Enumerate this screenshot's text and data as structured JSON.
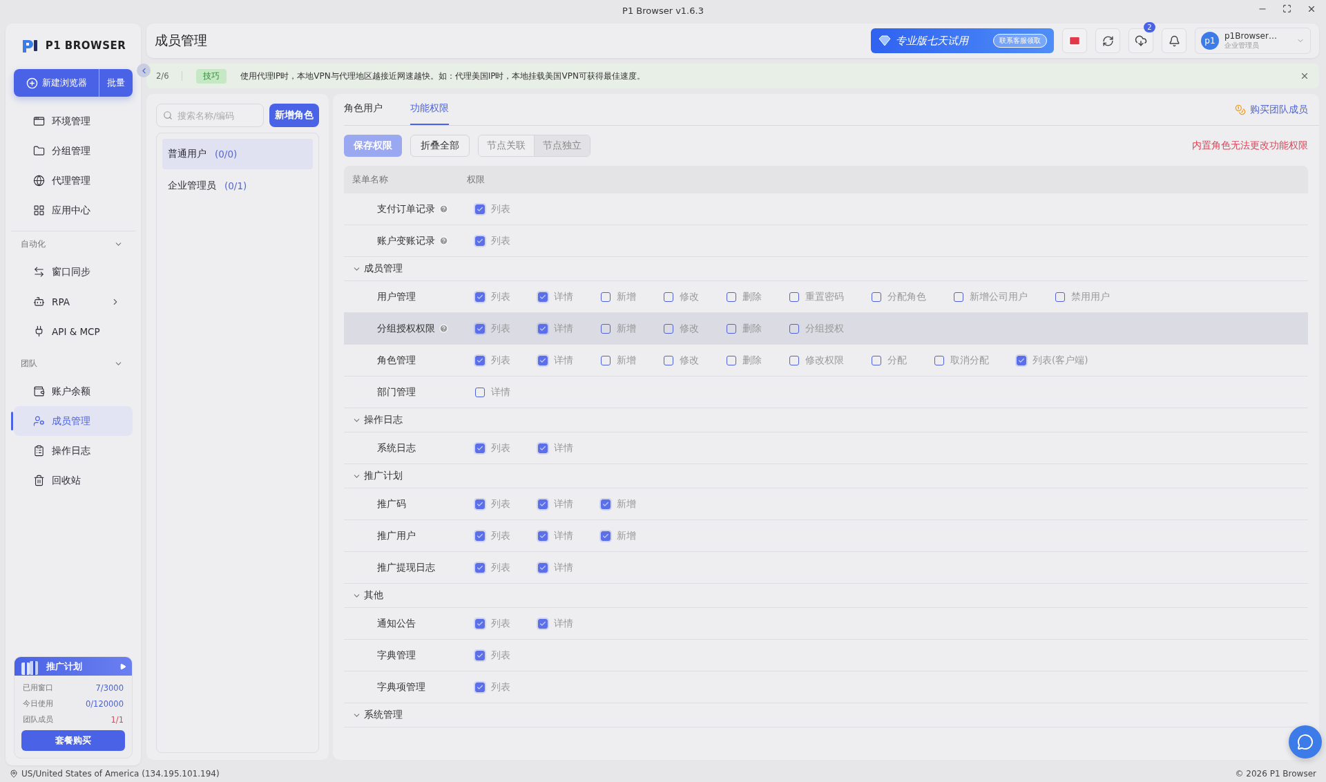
{
  "window": {
    "title": "P1 Browser v1.6.3"
  },
  "sidebar": {
    "logo": "P1 BROWSER",
    "new_button": "新建浏览器",
    "batch_button": "批量",
    "items": [
      {
        "label": "环境管理",
        "selected": false
      },
      {
        "label": "分组管理",
        "selected": false
      },
      {
        "label": "代理管理",
        "selected": false
      },
      {
        "label": "应用中心",
        "selected": false
      }
    ],
    "sections": [
      {
        "title": "自动化",
        "expanded": true,
        "items": [
          {
            "label": "窗口同步",
            "selected": false,
            "has_submenu": false
          },
          {
            "label": "RPA",
            "selected": false,
            "has_submenu": true
          },
          {
            "label": "API & MCP",
            "selected": false,
            "has_submenu": false
          }
        ]
      },
      {
        "title": "团队",
        "expanded": true,
        "items": [
          {
            "label": "账户余额",
            "selected": false,
            "has_submenu": false
          },
          {
            "label": "成员管理",
            "selected": true,
            "has_submenu": false
          },
          {
            "label": "操作日志",
            "selected": false,
            "has_submenu": false
          },
          {
            "label": "回收站",
            "selected": false,
            "has_submenu": false
          }
        ]
      }
    ],
    "promo": {
      "title": "推广计划",
      "stats": [
        {
          "label": "已用窗口",
          "value": "7/3000",
          "color": "#4a5fcf"
        },
        {
          "label": "今日使用",
          "value": "0/120000",
          "color": "#4a5fcf"
        },
        {
          "label": "团队成员",
          "value": "1/1",
          "color": "#d9475a"
        }
      ],
      "button": "套餐购买"
    }
  },
  "header": {
    "title": "成员管理",
    "trial": {
      "label": "专业版七天试用",
      "action": "联系客服领取"
    },
    "download_badge": "2",
    "user": {
      "avatar": "p1",
      "name": "p1Browser…",
      "role": "企业管理员"
    }
  },
  "tip": {
    "counter": "2/6",
    "badge": "技巧",
    "text": "使用代理IP时，本地VPN与代理地区越接近网速越快。如：代理美国IP时，本地挂载美国VPN可获得最佳速度。"
  },
  "roles": {
    "search_placeholder": "搜索名称/编码",
    "add_button": "新增角色",
    "items": [
      {
        "name": "普通用户",
        "count": "(0/0)",
        "selected": true
      },
      {
        "name": "企业管理员",
        "count": "(0/1)",
        "selected": false
      }
    ]
  },
  "permissions": {
    "tabs": [
      {
        "label": "角色用户",
        "selected": false
      },
      {
        "label": "功能权限",
        "selected": true
      }
    ],
    "buy_link": "购买团队成员",
    "save_button": "保存权限",
    "collapse_button": "折叠全部",
    "modes": [
      {
        "label": "节点关联",
        "selected": false
      },
      {
        "label": "节点独立",
        "selected": true
      }
    ],
    "notice": "内置角色无法更改功能权限",
    "columns": [
      "菜单名称",
      "权限"
    ],
    "rows": [
      {
        "kind": "item",
        "name": "支付订单记录",
        "help": true,
        "hovered": false,
        "options": [
          {
            "label": "列表",
            "checked": true
          }
        ]
      },
      {
        "kind": "item",
        "name": "账户变账记录",
        "help": true,
        "hovered": false,
        "options": [
          {
            "label": "列表",
            "checked": true
          }
        ]
      },
      {
        "kind": "group",
        "name": "成员管理",
        "expanded": true
      },
      {
        "kind": "item",
        "name": "用户管理",
        "help": false,
        "hovered": false,
        "options": [
          {
            "label": "列表",
            "checked": true
          },
          {
            "label": "详情",
            "checked": true
          },
          {
            "label": "新增",
            "checked": false
          },
          {
            "label": "修改",
            "checked": false
          },
          {
            "label": "删除",
            "checked": false
          },
          {
            "label": "重置密码",
            "checked": false
          },
          {
            "label": "分配角色",
            "checked": false
          },
          {
            "label": "新增公司用户",
            "checked": false
          },
          {
            "label": "禁用用户",
            "checked": false
          }
        ]
      },
      {
        "kind": "item",
        "name": "分组授权权限",
        "help": true,
        "hovered": true,
        "options": [
          {
            "label": "列表",
            "checked": true
          },
          {
            "label": "详情",
            "checked": true
          },
          {
            "label": "新增",
            "checked": false
          },
          {
            "label": "修改",
            "checked": false
          },
          {
            "label": "删除",
            "checked": false
          },
          {
            "label": "分组授权",
            "checked": false
          }
        ]
      },
      {
        "kind": "item",
        "name": "角色管理",
        "help": false,
        "hovered": false,
        "options": [
          {
            "label": "列表",
            "checked": true
          },
          {
            "label": "详情",
            "checked": true
          },
          {
            "label": "新增",
            "checked": false
          },
          {
            "label": "修改",
            "checked": false
          },
          {
            "label": "删除",
            "checked": false
          },
          {
            "label": "修改权限",
            "checked": false
          },
          {
            "label": "分配",
            "checked": false
          },
          {
            "label": "取消分配",
            "checked": false
          },
          {
            "label": "列表(客户端)",
            "checked": true
          }
        ]
      },
      {
        "kind": "item",
        "name": "部门管理",
        "help": false,
        "hovered": false,
        "options": [
          {
            "label": "详情",
            "checked": false
          }
        ]
      },
      {
        "kind": "group",
        "name": "操作日志",
        "expanded": true
      },
      {
        "kind": "item",
        "name": "系统日志",
        "help": false,
        "hovered": false,
        "options": [
          {
            "label": "列表",
            "checked": true
          },
          {
            "label": "详情",
            "checked": true
          }
        ]
      },
      {
        "kind": "group",
        "name": "推广计划",
        "expanded": true
      },
      {
        "kind": "item",
        "name": "推广码",
        "help": false,
        "hovered": false,
        "options": [
          {
            "label": "列表",
            "checked": true
          },
          {
            "label": "详情",
            "checked": true
          },
          {
            "label": "新增",
            "checked": true
          }
        ]
      },
      {
        "kind": "item",
        "name": "推广用户",
        "help": false,
        "hovered": false,
        "options": [
          {
            "label": "列表",
            "checked": true
          },
          {
            "label": "详情",
            "checked": true
          },
          {
            "label": "新增",
            "checked": true
          }
        ]
      },
      {
        "kind": "item",
        "name": "推广提现日志",
        "help": false,
        "hovered": false,
        "options": [
          {
            "label": "列表",
            "checked": true
          },
          {
            "label": "详情",
            "checked": true
          }
        ]
      },
      {
        "kind": "group",
        "name": "其他",
        "expanded": true
      },
      {
        "kind": "item",
        "name": "通知公告",
        "help": false,
        "hovered": false,
        "options": [
          {
            "label": "列表",
            "checked": true
          },
          {
            "label": "详情",
            "checked": true
          }
        ]
      },
      {
        "kind": "item",
        "name": "字典管理",
        "help": false,
        "hovered": false,
        "options": [
          {
            "label": "列表",
            "checked": true
          }
        ]
      },
      {
        "kind": "item",
        "name": "字典项管理",
        "help": false,
        "hovered": false,
        "options": [
          {
            "label": "列表",
            "checked": true
          }
        ]
      },
      {
        "kind": "group",
        "name": "系统管理",
        "expanded": true
      }
    ]
  },
  "status_bar": {
    "location": "US/United States of America (134.195.101.194)",
    "copyright": "© 2026 P1 Browser"
  }
}
